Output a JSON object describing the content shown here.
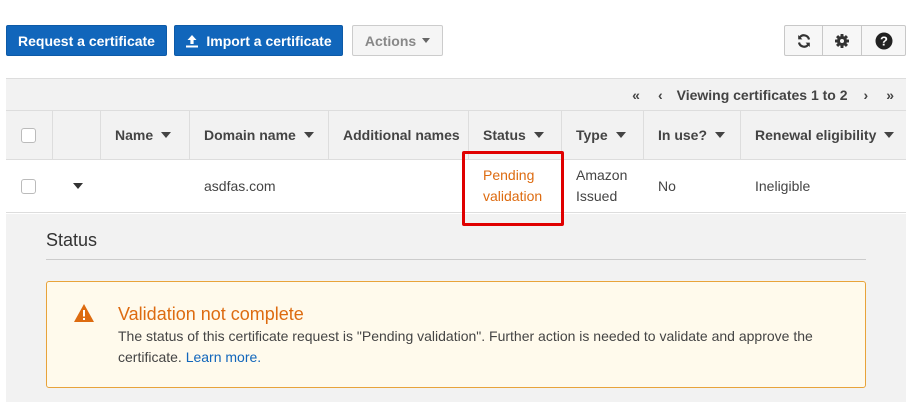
{
  "toolbar": {
    "request_label": "Request a certificate",
    "import_label": "Import a certificate",
    "actions_label": "Actions",
    "refresh_icon": "refresh-icon",
    "settings_icon": "gear-icon",
    "help_icon": "help-icon"
  },
  "pager": {
    "first": "«",
    "prev": "‹",
    "text": "Viewing certificates 1 to 2",
    "next": "›",
    "last": "»"
  },
  "table": {
    "columns": [
      "Name",
      "Domain name",
      "Additional names",
      "Status",
      "Type",
      "In use?",
      "Renewal eligibility"
    ],
    "rows": [
      {
        "name": "",
        "domain": "asdfas.com",
        "additional": "",
        "status_line1": "Pending",
        "status_line2": "validation",
        "type_line1": "Amazon",
        "type_line2": "Issued",
        "in_use": "No",
        "renewal": "Ineligible"
      }
    ]
  },
  "details": {
    "title": "Status",
    "alert": {
      "title": "Validation not complete",
      "body": "The status of this certificate request is \"Pending validation\". Further action is needed to validate and approve the certificate.",
      "link": "Learn more."
    }
  },
  "colors": {
    "primary": "#1166bb",
    "warning": "#dd6b10",
    "highlight": "#e00000"
  }
}
